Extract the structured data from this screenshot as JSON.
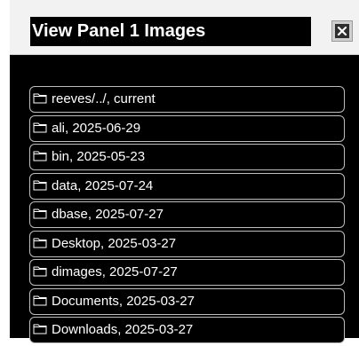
{
  "dialog": {
    "title": "View Panel 1 Images",
    "close_icon": "close-icon"
  },
  "folder_icon": "folder-icon",
  "items": [
    {
      "label": "reeves/../, current"
    },
    {
      "label": "ali, 2025-06-29"
    },
    {
      "label": "bin, 2025-05-23"
    },
    {
      "label": "data, 2025-07-24"
    },
    {
      "label": "dbase, 2025-07-27"
    },
    {
      "label": "Desktop, 2025-03-27"
    },
    {
      "label": "dimages, 2025-07-27"
    },
    {
      "label": "Documents, 2025-03-27"
    },
    {
      "label": "Downloads, 2025-03-27"
    }
  ],
  "colors": {
    "background": "#000000",
    "header": "#f2f2f2",
    "text": "#ffffff",
    "item_border": "#bdbdbd"
  }
}
